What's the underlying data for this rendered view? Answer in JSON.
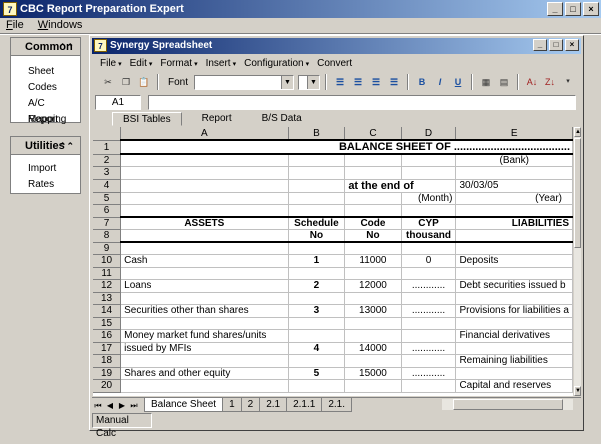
{
  "app": {
    "title": "CBC Report Preparation Expert",
    "menu": [
      "File",
      "Windows"
    ]
  },
  "side": {
    "common": {
      "header": "Common",
      "items": [
        "Sheet",
        "Codes",
        "A/C Mapping",
        "Report"
      ]
    },
    "utilities": {
      "header": "Utilities",
      "items": [
        "Import",
        "Rates"
      ]
    }
  },
  "inner": {
    "title": "Synergy Spreadsheet",
    "menu": [
      "File",
      "Edit",
      "Format",
      "Insert",
      "Configuration",
      "Convert"
    ],
    "font_label": "Font",
    "cell_ref": "A1",
    "top_tabs": [
      "BSI Tables",
      "Report",
      "B/S Data"
    ],
    "sheet_tabs": [
      "Balance Sheet",
      "1",
      "2",
      "2.1",
      "2.1.1",
      "2.1."
    ],
    "status": "Manual Calc"
  },
  "grid": {
    "columns": [
      "A",
      "B",
      "C",
      "D",
      "E"
    ],
    "rows": [
      {
        "n": "1",
        "a": "",
        "b": "",
        "c": "",
        "d": "",
        "e": ""
      },
      {
        "n": "2",
        "a": "",
        "b": "",
        "c": "",
        "d": "",
        "e": "(Bank)"
      },
      {
        "n": "3",
        "a": "",
        "b": "",
        "c": "",
        "d": "",
        "e": ""
      },
      {
        "n": "4",
        "a": "",
        "b": "",
        "c": "at the end of",
        "d": "",
        "e": "30/03/05"
      },
      {
        "n": "5",
        "a": "",
        "b": "",
        "c": "",
        "d": "(Month)",
        "e": "(Year)"
      },
      {
        "n": "6",
        "a": "",
        "b": "",
        "c": "",
        "d": "",
        "e": ""
      },
      {
        "n": "7",
        "a": "ASSETS",
        "b": "Schedule",
        "c": "Code",
        "d": "CYP",
        "e": "LIABILITIES"
      },
      {
        "n": "8",
        "a": "",
        "b": "No",
        "c": "No",
        "d": "thousand",
        "e": ""
      },
      {
        "n": "9",
        "a": "",
        "b": "",
        "c": "",
        "d": "",
        "e": ""
      },
      {
        "n": "10",
        "a": "Cash",
        "b": "1",
        "c": "11000",
        "d": "0",
        "e": "Deposits"
      },
      {
        "n": "11",
        "a": "",
        "b": "",
        "c": "",
        "d": "",
        "e": ""
      },
      {
        "n": "12",
        "a": "Loans",
        "b": "2",
        "c": "12000",
        "d": "............",
        "e": "Debt securities issued b"
      },
      {
        "n": "13",
        "a": "",
        "b": "",
        "c": "",
        "d": "",
        "e": ""
      },
      {
        "n": "14",
        "a": "Securities other  than shares",
        "b": "3",
        "c": "13000",
        "d": "............",
        "e": "Provisions for liabilities a"
      },
      {
        "n": "15",
        "a": "",
        "b": "",
        "c": "",
        "d": "",
        "e": ""
      },
      {
        "n": "16",
        "a": "Money market fund shares/units",
        "b": "",
        "c": "",
        "d": "",
        "e": "Financial derivatives"
      },
      {
        "n": "17",
        "a": "issued by MFIs",
        "b": "4",
        "c": "14000",
        "d": "............",
        "e": ""
      },
      {
        "n": "18",
        "a": "",
        "b": "",
        "c": "",
        "d": "",
        "e": "Remaining liabilities"
      },
      {
        "n": "19",
        "a": "Shares and other equity",
        "b": "5",
        "c": "15000",
        "d": "............",
        "e": ""
      },
      {
        "n": "20",
        "a": "",
        "b": "",
        "c": "",
        "d": "",
        "e": "Capital and reserves"
      }
    ],
    "balance_sheet_title": "BALANCE SHEET OF  ......................................"
  }
}
